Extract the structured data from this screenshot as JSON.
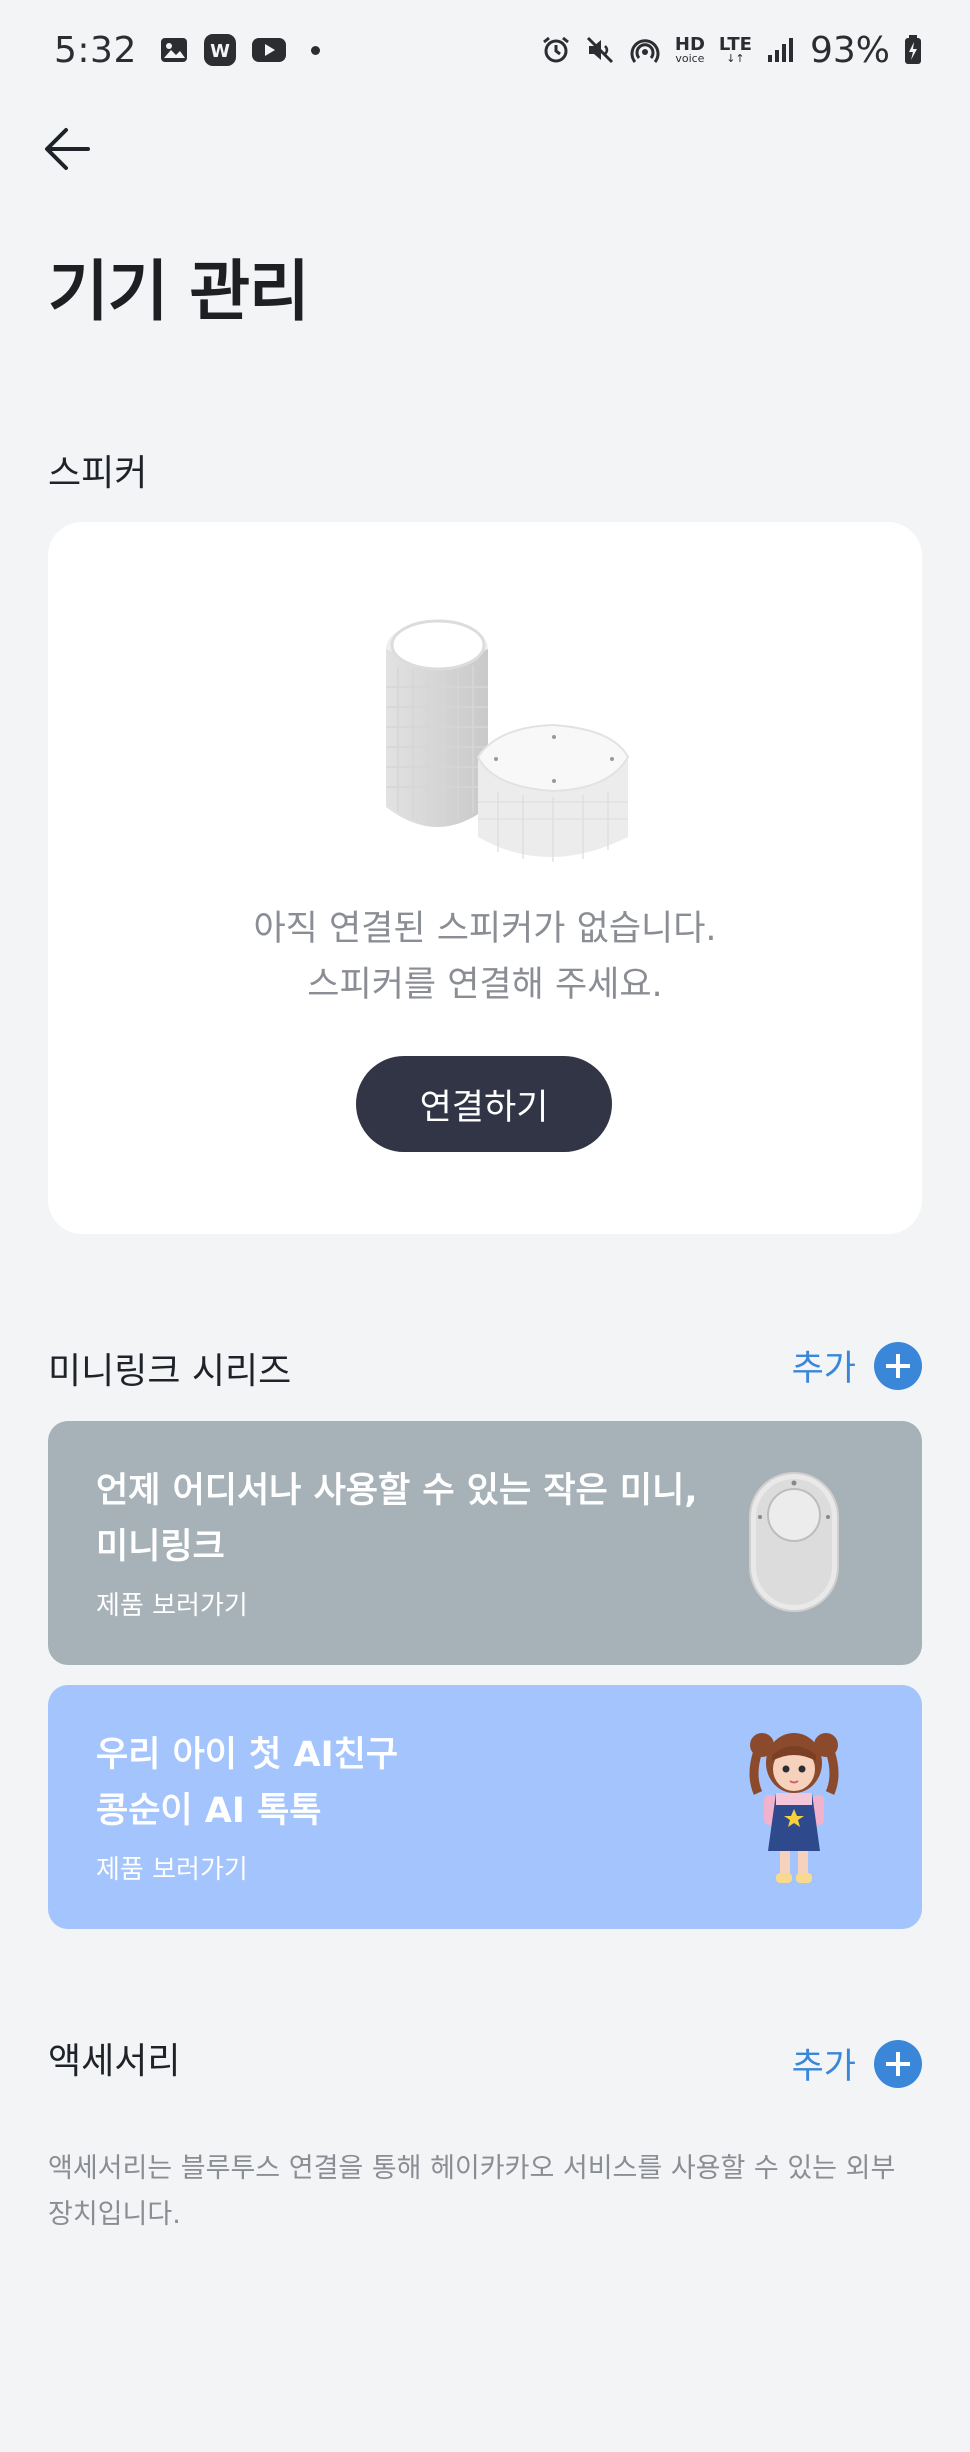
{
  "status_bar": {
    "time": "5:32",
    "battery": "93%",
    "hd_label": "HD",
    "hd_sub": "voice",
    "lte_label": "LTE"
  },
  "page": {
    "title": "기기 관리"
  },
  "speaker_section": {
    "title": "스피커",
    "empty_line1": "아직 연결된 스피커가 없습니다.",
    "empty_line2": "스피커를 연결해 주세요.",
    "connect_label": "연결하기"
  },
  "minilink_section": {
    "title": "미니링크 시리즈",
    "add_label": "추가",
    "cards": [
      {
        "line1": "언제 어디서나 사용할 수 있는 작은 미니,",
        "line2": "미니링크",
        "link": "제품 보러가기",
        "color": "#a7b1b8"
      },
      {
        "line1": "우리 아이 첫 AI친구",
        "line2": "콩순이 AI 톡톡",
        "link": "제품 보러가기",
        "color": "#a3c4fc"
      }
    ]
  },
  "accessory_section": {
    "title": "액세서리",
    "add_label": "추가",
    "description": "액세서리는 블루투스 연결을 통해 헤이카카오 서비스를 사용할 수 있는 외부 장치입니다."
  },
  "colors": {
    "background": "#f3f4f6",
    "accent": "#3a86d8",
    "button_dark": "#323545"
  },
  "icons": [
    "image-icon",
    "w-app-icon",
    "youtube-icon",
    "alarm-icon",
    "mute-icon",
    "hotspot-icon",
    "signal-icon",
    "battery-icon",
    "back-arrow-icon",
    "plus-icon"
  ]
}
